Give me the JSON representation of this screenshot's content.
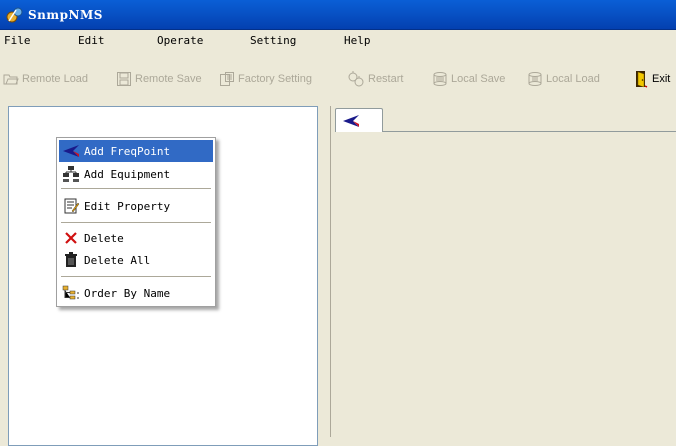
{
  "window": {
    "title": "SnmpNMS"
  },
  "menubar": {
    "items": [
      "File",
      "Edit",
      "Operate",
      "Setting",
      "Help"
    ]
  },
  "toolbar": {
    "buttons": [
      {
        "label": "Remote Load",
        "icon": "folder-open-icon",
        "enabled": false
      },
      {
        "label": "Remote Save",
        "icon": "floppy-disk-icon",
        "enabled": false
      },
      {
        "label": "Factory Setting",
        "icon": "factory-setting-icon",
        "enabled": false
      },
      {
        "label": "Restart",
        "icon": "restart-icon",
        "enabled": false
      },
      {
        "label": "Local Save",
        "icon": "local-save-icon",
        "enabled": false
      },
      {
        "label": "Local Load",
        "icon": "local-load-icon",
        "enabled": false
      },
      {
        "label": "Exit",
        "icon": "exit-door-icon",
        "enabled": true
      }
    ]
  },
  "context_menu": {
    "items": [
      {
        "label": "Add FreqPoint",
        "icon": "freqpoint-arrow-icon",
        "selected": true
      },
      {
        "label": "Add Equipment",
        "icon": "equipment-icon",
        "selected": false
      },
      {
        "label": "Edit Property",
        "icon": "edit-property-icon",
        "selected": false
      },
      {
        "label": "Delete",
        "icon": "delete-x-icon",
        "selected": false
      },
      {
        "label": "Delete All",
        "icon": "trash-can-icon",
        "selected": false
      },
      {
        "label": "Order By Name",
        "icon": "tree-order-icon",
        "selected": false
      }
    ]
  },
  "colors": {
    "titlebar": "#0853c7",
    "menu_highlight": "#316ac5",
    "window_bg": "#ece9d8"
  }
}
